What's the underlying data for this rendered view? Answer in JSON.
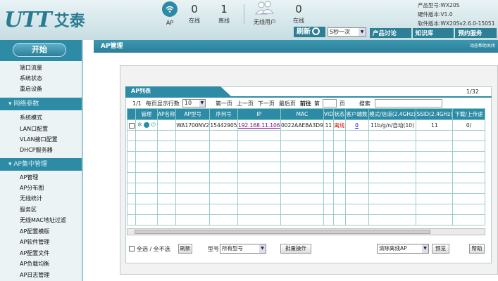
{
  "brand": {
    "logo_latin": "UTT",
    "logo_cn": "艾泰"
  },
  "stats": [
    {
      "icon": "wifi-icon",
      "value": "",
      "label": "AP"
    },
    {
      "value": "0",
      "label": "在线"
    },
    {
      "value": "1",
      "label": "离线"
    },
    {
      "icon": "users-icon",
      "value": "",
      "label": "无线用户"
    },
    {
      "value": "0",
      "label": "在线"
    }
  ],
  "product_info": {
    "model": "产品型号:WX20S",
    "hw": "硬件版本:V1.0",
    "sw": "软件版本:WX20Sv2.6.0-15051"
  },
  "refresh": {
    "label": "刷新",
    "interval": "5秒一次"
  },
  "top_links": [
    "产品讨论",
    "知识库",
    "预约服务"
  ],
  "sidebar": {
    "start": "开始",
    "top_items": [
      "端口流量",
      "系统状态",
      "重启设备"
    ],
    "network_header": "网络参数",
    "network_items": [
      "系统模式",
      "LAN口配置",
      "VLAN接口配置",
      "DHCP服务器"
    ],
    "ap_header": "AP集中管理",
    "ap_items": [
      "AP管理",
      "AP分布图",
      "无线统计",
      "服务区",
      "无线MAC地址过滤",
      "AP配置模版",
      "AP软件管理",
      "AP配置文件",
      "AP负载均衡",
      "AP日志管理"
    ]
  },
  "page_title": "AP管理",
  "help_link": "动态帮助关闭",
  "panel": {
    "tab_title": "AP列表",
    "page_count": "1/32",
    "pager": {
      "page": "1/1",
      "rows_label": "每页显示行数",
      "rows_value": "10",
      "first": "第一页",
      "prev": "上一页",
      "next": "下一页",
      "last": "最后页",
      "goto": "前往",
      "di": "第",
      "ye": "页",
      "search": "搜索"
    },
    "columns": [
      "",
      "管理",
      "AP名称",
      "AP型号",
      "序列号",
      "IP",
      "MAC",
      "VID",
      "状态",
      "客户端数",
      "模式/信道(2.4GHz)",
      "SSID(2.4GHz)",
      "下载/上传速"
    ],
    "rows": [
      {
        "name": "",
        "model": "WA1700NV2",
        "serial": "15442905",
        "ip": "192.168.11.106",
        "mac": "0022AAEBA3D9",
        "vid": "11",
        "status": "离线",
        "clients": "0",
        "mode": "11b/g/n/自动(10)",
        "ssid": "11",
        "rate": "0/"
      }
    ],
    "bottom": {
      "select_all": "全选 / 全不选",
      "refresh": "刷新",
      "model_label": "型号",
      "model_value": "所有型号",
      "batch": "批量操作",
      "clear_value": "清除离线AP",
      "preview": "预览",
      "help": "帮助"
    }
  }
}
